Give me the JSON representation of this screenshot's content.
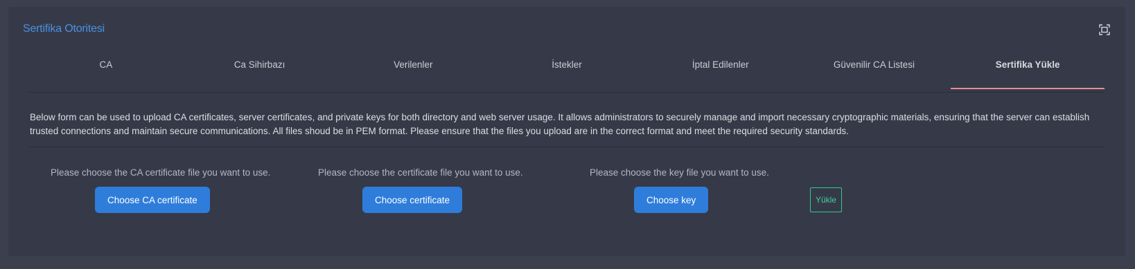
{
  "panel": {
    "title": "Sertifika Otoritesi",
    "expand_icon": "expand-icon"
  },
  "tabs": [
    {
      "label": "CA",
      "active": false
    },
    {
      "label": "Ca Sihirbazı",
      "active": false
    },
    {
      "label": "Verilenler",
      "active": false
    },
    {
      "label": "İstekler",
      "active": false
    },
    {
      "label": "İptal Edilenler",
      "active": false
    },
    {
      "label": "Güvenilir CA Listesi",
      "active": false
    },
    {
      "label": "Sertifika Yükle",
      "active": true
    }
  ],
  "description": "Below form can be used to upload CA certificates, server certificates, and private keys for both directory and web server usage. It allows administrators to securely manage and import necessary cryptographic materials, ensuring that the server can establish trusted connections and maintain secure communications. All files shoud be in PEM format. Please ensure that the files you upload are in the correct format and meet the required security standards.",
  "upload": {
    "ca": {
      "hint": "Please choose the CA certificate file you want to use.",
      "button": "Choose CA certificate"
    },
    "cert": {
      "hint": "Please choose the certificate file you want to use.",
      "button": "Choose certificate"
    },
    "key": {
      "hint": "Please choose the key file you want to use.",
      "button": "Choose key"
    },
    "submit": "Yükle"
  },
  "colors": {
    "accent": "#4a90e2",
    "button": "#2f7ddb",
    "active_tab_underline": "#e98a9b",
    "submit_border": "#2ecc8f"
  }
}
